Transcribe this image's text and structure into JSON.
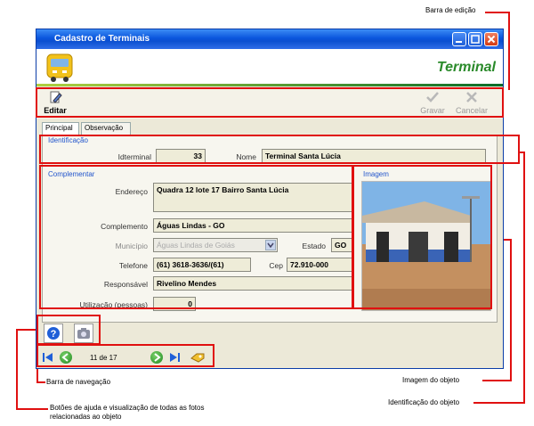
{
  "callouts": {
    "toolbar": "Barra de edição",
    "navigation": "Barra de navegação",
    "image": "Imagem do objeto",
    "identification": "Identificação do objeto",
    "help_photos_line1": "Botões de ajuda e visualização de todas as fotos",
    "help_photos_line2": "relacionadas ao objeto"
  },
  "window": {
    "title": "Cadastro de Terminais",
    "header_title": "Terminal"
  },
  "toolbar": {
    "edit_label": "Editar",
    "save_label": "Gravar",
    "cancel_label": "Cancelar"
  },
  "tabs": [
    {
      "label": "Principal",
      "active": true
    },
    {
      "label": "Observação",
      "active": false
    }
  ],
  "identificacao": {
    "legend": "Identificação",
    "id_label": "Idterminal",
    "id_value": "33",
    "name_label": "Nome",
    "name_value": "Terminal Santa Lúcia"
  },
  "complementar": {
    "legend": "Complementar",
    "address_label": "Endereço",
    "address_value": "Quadra 12 lote 17 Bairro Santa Lúcia",
    "complement_label": "Complemento",
    "complement_value": "Águas Lindas - GO",
    "municipality_label": "Município",
    "municipality_value": "Águas Lindas de Goiás",
    "state_label": "Estado",
    "state_value": "GO",
    "phone_label": "Telefone",
    "phone_value": "(61) 3618-3636/(61)",
    "cep_label": "Cep",
    "cep_value": "72.910-000",
    "responsible_label": "Responsável",
    "responsible_value": "Rivelino Mendes",
    "usage_label": "Utilização (pessoas)",
    "usage_value": "0"
  },
  "imagem": {
    "legend": "Imagem"
  },
  "navigation": {
    "record_text": "11 de 17"
  },
  "colors": {
    "callout_red": "#e01010",
    "title_blue": "#0b4fd0",
    "legend_blue": "#2255cc",
    "header_green": "#2a8a2a"
  }
}
